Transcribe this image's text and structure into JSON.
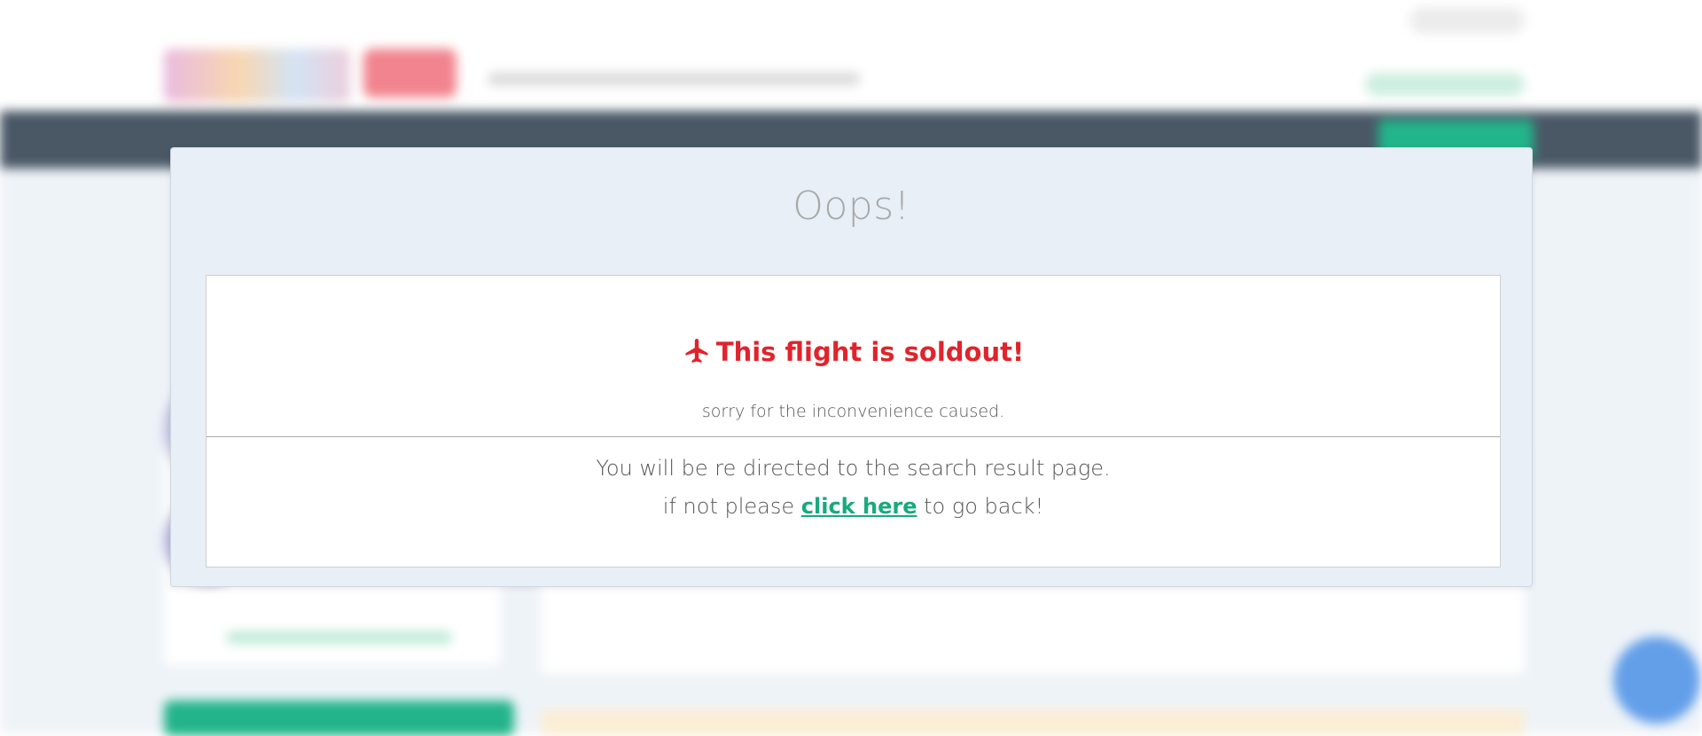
{
  "modal": {
    "title": "Oops!",
    "headline": "This flight is soldout!",
    "headline_icon": "airplane-icon",
    "subtext": "sorry for the inconvenience caused.",
    "redirect_line": "You will be re directed to the search result page.",
    "fallback_prefix": "if not please",
    "fallback_link": "click here",
    "fallback_suffix": "to go back!"
  },
  "colors": {
    "headline_red": "#e0242c",
    "link_green": "#1aa97e",
    "title_gray": "#a8a8a8",
    "modal_bg": "#e8eff6",
    "nav_dark": "#4a5866"
  }
}
